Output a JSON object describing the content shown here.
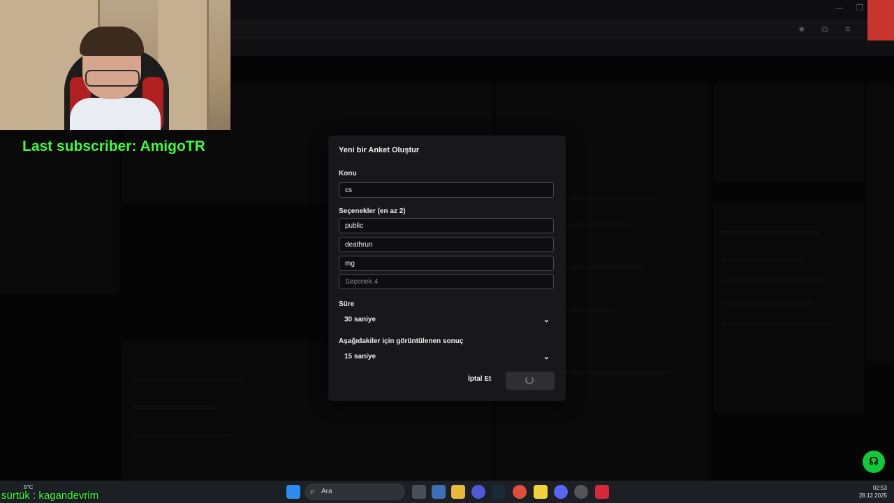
{
  "modal": {
    "title": "Yeni bir Anket Oluştur",
    "topic_label": "Konu",
    "topic_value": "cs",
    "options_label": "Seçenekler (en az 2)",
    "options": [
      {
        "value": "public",
        "placeholder": ""
      },
      {
        "value": "deathrun",
        "placeholder": ""
      },
      {
        "value": "mg",
        "placeholder": ""
      },
      {
        "value": "",
        "placeholder": "Seçenek 4"
      }
    ],
    "duration_label": "Süre",
    "duration_value": "30 saniye",
    "result_label": "Aşağıdakiler için görüntülenen sonuç",
    "result_value": "15 saniye",
    "cancel_label": "İptal Et"
  },
  "overlay": {
    "last_subscriber": "Last subscriber: AmigoTR",
    "bottom_ticker": "sürtük : kagandevrim"
  },
  "taskbar": {
    "search_placeholder": "Ara",
    "weather": "5°C",
    "time": "02:53",
    "date": "28.12.2025"
  },
  "colors": {
    "accent_green": "#3cff3c",
    "modal_bg": "#18181b",
    "help_fab": "#12c93a"
  }
}
